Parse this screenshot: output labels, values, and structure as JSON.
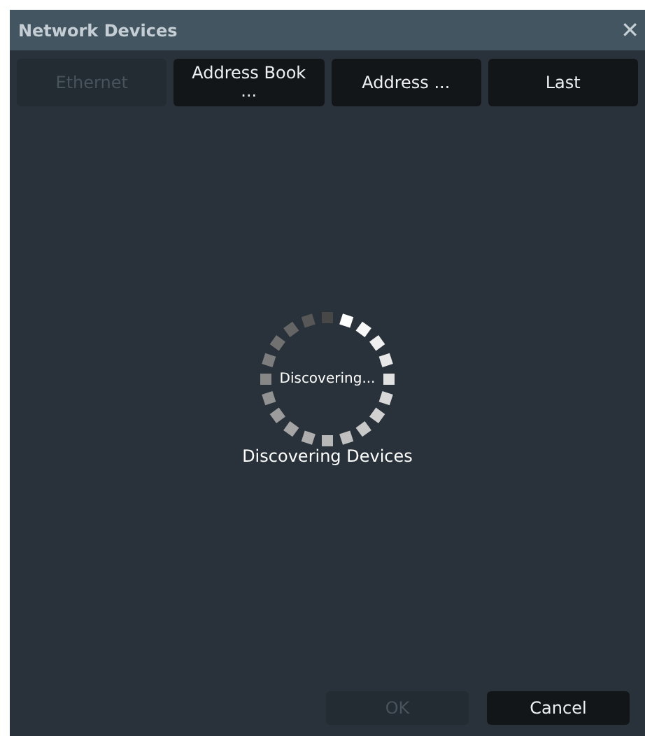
{
  "window": {
    "title": "Network Devices",
    "close": "✕"
  },
  "tabs": [
    {
      "label": "Ethernet",
      "disabled": true
    },
    {
      "label": "Address Book ...",
      "disabled": false
    },
    {
      "label": "Address ...",
      "disabled": false
    },
    {
      "label": "Last",
      "disabled": false
    }
  ],
  "spinner": {
    "label": "Discovering..."
  },
  "status": "Discovering Devices",
  "buttons": [
    {
      "label": "OK",
      "disabled": true
    },
    {
      "label": "Cancel",
      "disabled": false
    }
  ]
}
